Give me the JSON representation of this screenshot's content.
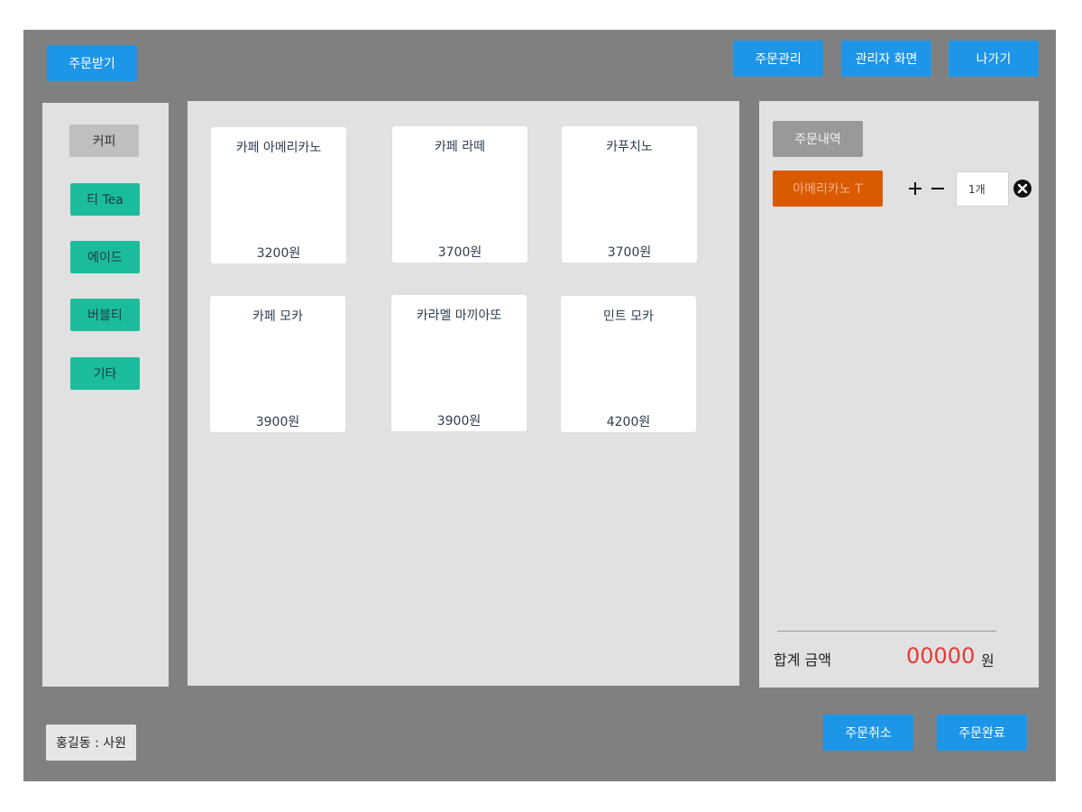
{
  "header": {
    "receive_order": "주문받기",
    "order_manage": "주문관리",
    "admin_screen": "관리자 화면",
    "exit": "나가기"
  },
  "categories": [
    {
      "label": "커피",
      "active": true
    },
    {
      "label": "티 Tea",
      "active": false
    },
    {
      "label": "에이드",
      "active": false
    },
    {
      "label": "버블티",
      "active": false
    },
    {
      "label": "기타",
      "active": false
    }
  ],
  "menu": [
    {
      "name": "카페 아메리카노",
      "price": "3200원"
    },
    {
      "name": "카페 라떼",
      "price": "3700원"
    },
    {
      "name": "카푸치노",
      "price": "3700원"
    },
    {
      "name": "카페 모카",
      "price": "3900원"
    },
    {
      "name": "카라멜 마끼아또",
      "price": "3900원"
    },
    {
      "name": "민트 모카",
      "price": "4200원"
    }
  ],
  "order": {
    "title": "주문내역",
    "items": [
      {
        "name": "아메리카노 T",
        "quantity": "1개"
      }
    ],
    "plus_icon": "plus-icon",
    "minus_icon": "minus-icon",
    "remove_icon": "close-circle-icon",
    "total_label": "합계 금액",
    "total_value": "00000",
    "total_unit": "원"
  },
  "footer": {
    "user": "홍길동 : 사원",
    "cancel": "주문취소",
    "complete": "주문완료"
  },
  "colors": {
    "frame": "#808080",
    "panel": "#e1e1e1",
    "accent_blue": "#1e96e8",
    "category_green": "#1bbc9b",
    "order_item": "#d95a00",
    "total_red": "#e53935"
  }
}
